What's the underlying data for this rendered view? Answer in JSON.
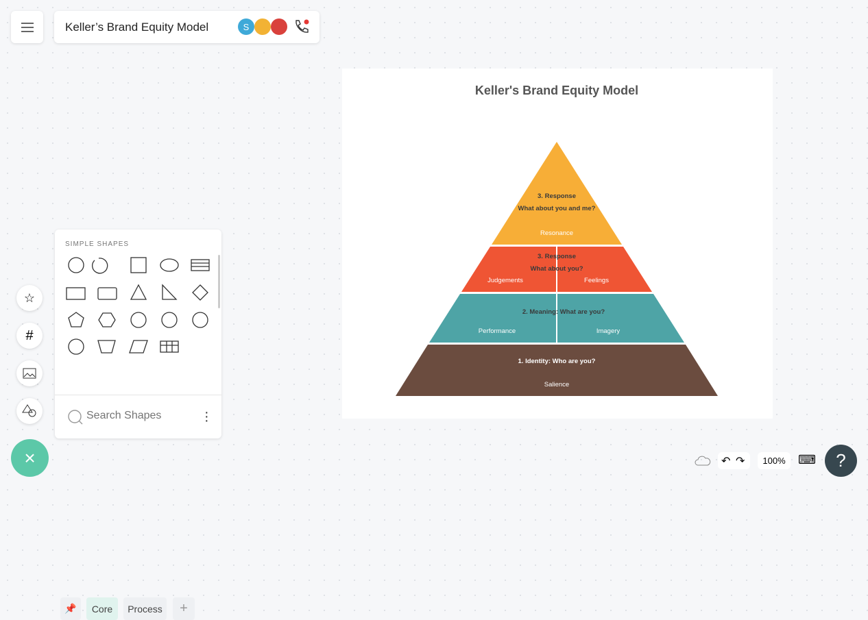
{
  "header": {
    "title": "Keller’s Brand Equity Model",
    "avatar_initial": "S",
    "menu_icon": "hamburger-icon",
    "call_icon": "phone-icon"
  },
  "colors": {
    "orange": "#f7ae37",
    "red": "#ef5534",
    "teal": "#4ea4a6",
    "brown": "#6b4c3f",
    "fab": "#5cc8a8",
    "help": "#37474f"
  },
  "diagram": {
    "title": "Keller's Brand Equity Model",
    "levels": [
      {
        "heading": "3. Response",
        "question": "What about you and me?",
        "labels": [
          "Resonance"
        ]
      },
      {
        "heading": "3. Response",
        "question": "What about you?",
        "labels": [
          "Judgements",
          "Feelings"
        ]
      },
      {
        "heading": "2. Meaning: What are you?",
        "labels": [
          "Performance",
          "Imagery"
        ]
      },
      {
        "heading": "1. Identity: Who are you?",
        "labels": [
          "Salience"
        ]
      }
    ]
  },
  "shapes_panel": {
    "section": "SIMPLE SHAPES",
    "tabs": [
      "Core",
      "Process"
    ],
    "search_placeholder": "Search Shapes"
  },
  "bottom_bar": {
    "zoom": "100%",
    "help": "?"
  }
}
